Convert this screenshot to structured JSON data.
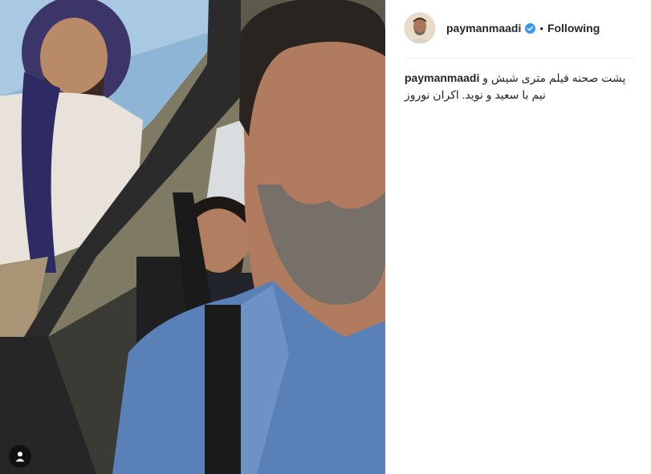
{
  "post": {
    "username": "paymanmaadi",
    "separator": "•",
    "follow_state": "Following",
    "caption": "پشت صحنه فیلم متری شیش و نیم با سعید و نوید. اکران نوروز"
  },
  "icons": {
    "verified": "verified-badge-icon",
    "user_tags": "user-tag-icon"
  },
  "colors": {
    "verified_blue": "#3897f0",
    "shirt_blue": "#5a80b8",
    "divider": "#efefef"
  }
}
